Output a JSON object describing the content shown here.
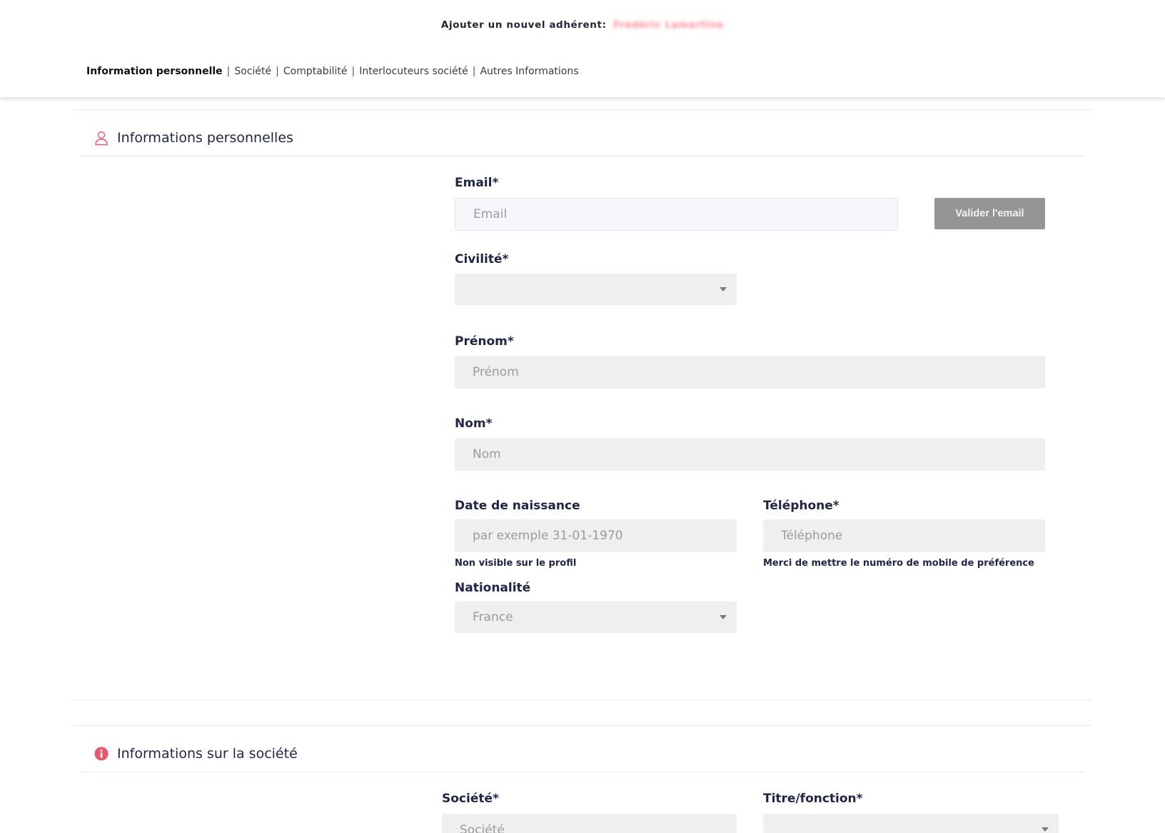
{
  "header": {
    "title": "Ajouter un nouvel adhérent:",
    "member_name": "Frédéric Lamartine"
  },
  "tabs": [
    {
      "label": "Information personnelle",
      "active": true
    },
    {
      "label": "Société",
      "active": false
    },
    {
      "label": "Comptabilité",
      "active": false
    },
    {
      "label": "Interlocuteurs société",
      "active": false
    },
    {
      "label": "Autres Informations",
      "active": false
    }
  ],
  "tab_separator": "|",
  "personal_section": {
    "title": "Informations personnelles",
    "icon": "user-icon",
    "email": {
      "label": "Email*",
      "placeholder": "Email"
    },
    "validate_button": "Valider l'email",
    "civility": {
      "label": "Civilité*",
      "value": ""
    },
    "first_name": {
      "label": "Prénom*",
      "placeholder": "Prénom"
    },
    "last_name": {
      "label": "Nom*",
      "placeholder": "Nom"
    },
    "birth_date": {
      "label": "Date de naissance",
      "placeholder": "par exemple 31-01-1970",
      "help": "Non visible sur le profil"
    },
    "phone": {
      "label": "Téléphone*",
      "placeholder": "Téléphone",
      "help": "Merci de mettre le numéro de mobile de préférence"
    },
    "nationality": {
      "label": "Nationalité",
      "value": "France"
    }
  },
  "company_section": {
    "title": "Informations sur la société",
    "icon": "info-circle-icon",
    "company": {
      "label": "Société*",
      "placeholder": "Société"
    },
    "job_title": {
      "label": "Titre/fonction*",
      "value": ""
    }
  },
  "colors": {
    "accent": "#f0566b",
    "text_dark": "#1e2548",
    "field_bg": "#efefef",
    "button_bg": "#959595"
  }
}
